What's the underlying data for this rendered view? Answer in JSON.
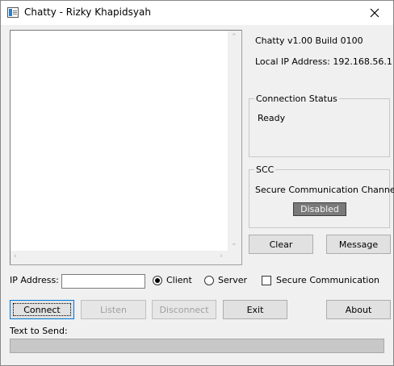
{
  "window": {
    "title": "Chatty - Rizky Khapidsyah"
  },
  "icons": {
    "app": "app-icon",
    "close": "close-icon",
    "scroll_up": "scroll-up-arrow-icon",
    "scroll_down": "scroll-down-arrow-icon",
    "scroll_left": "scroll-left-arrow-icon",
    "scroll_right": "scroll-right-arrow-icon"
  },
  "info": {
    "version": "Chatty v1.00 Build 0100",
    "local_ip": "Local IP Address: 192.168.56.1"
  },
  "connection_status": {
    "title": "Connection Status",
    "value": "Ready"
  },
  "scc": {
    "title": "SCC",
    "label": "Secure Communication Channel",
    "state": "Disabled",
    "state_color": "#7a7a7a"
  },
  "actions": {
    "clear": "Clear",
    "message": "Message"
  },
  "connection": {
    "ip_label": "IP Address:",
    "ip_value": "",
    "mode_client": "Client",
    "mode_server": "Server",
    "selected_mode": "Client",
    "secure_label": "Secure Communication",
    "secure_checked": false
  },
  "buttons": {
    "connect": "Connect",
    "listen": "Listen",
    "disconnect": "Disconnect",
    "exit": "Exit",
    "about": "About"
  },
  "send": {
    "label": "Text to Send:",
    "value": ""
  },
  "colors": {
    "focus_border": "#0078d7",
    "window_bg": "#f0f0f0"
  }
}
